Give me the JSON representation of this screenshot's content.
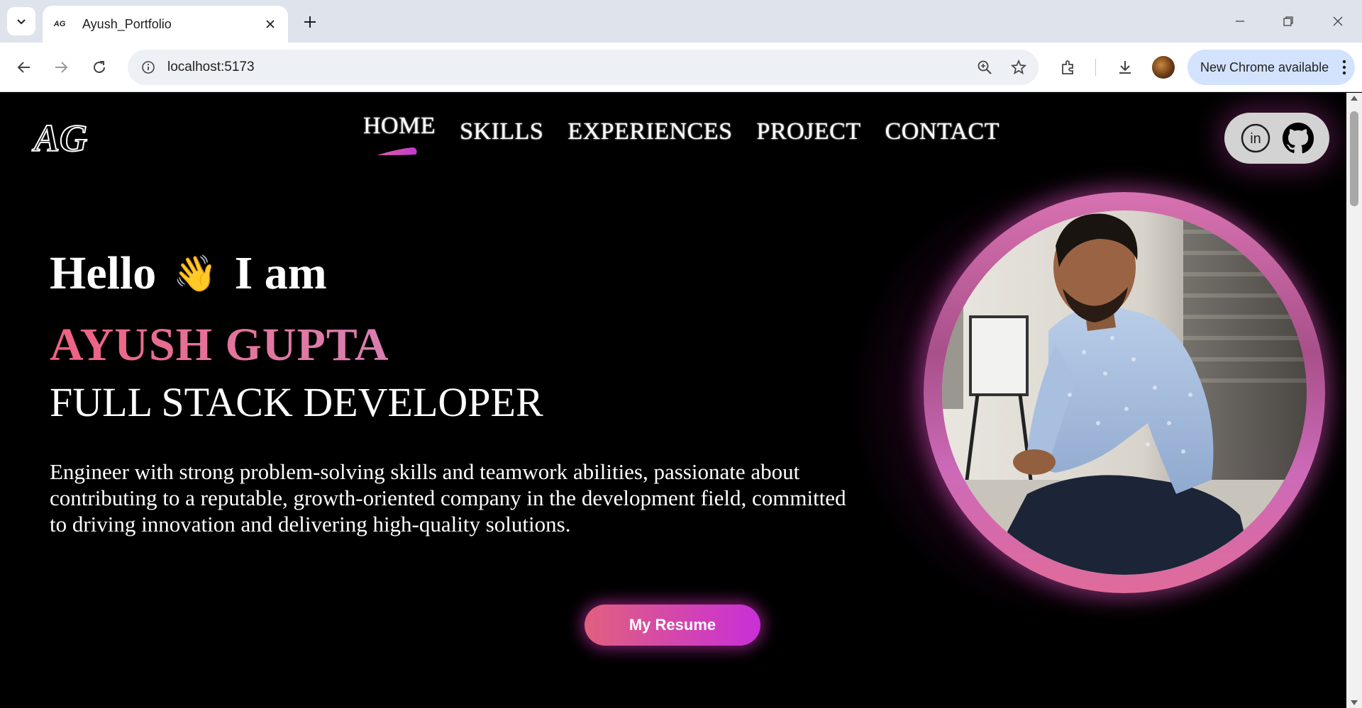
{
  "browser": {
    "tab_title": "Ayush_Portfolio",
    "tab_favicon_text": "AG",
    "url": "localhost:5173",
    "update_label": "New Chrome available"
  },
  "site": {
    "logo_text": "AG",
    "nav": [
      {
        "label": "HOME",
        "active": true
      },
      {
        "label": "SKILLS"
      },
      {
        "label": "EXPERIENCES"
      },
      {
        "label": "PROJECT"
      },
      {
        "label": "CONTACT"
      }
    ],
    "social": {
      "linkedin_text": "in"
    }
  },
  "hero": {
    "hello": "Hello",
    "wave": "👋",
    "i_am": "I am",
    "name": "AYUSH GUPTA",
    "role": "FULL STACK DEVELOPER",
    "description": "Engineer with strong problem-solving skills and teamwork abilities, passionate about contributing to a reputable, growth-oriented company in the development field, committed to driving innovation and delivering high-quality solutions.",
    "resume_label": "My Resume"
  },
  "colors": {
    "accent_pink": "#e0607e",
    "accent_purple": "#c92fd8",
    "update_pill": "#d3e3fd"
  }
}
